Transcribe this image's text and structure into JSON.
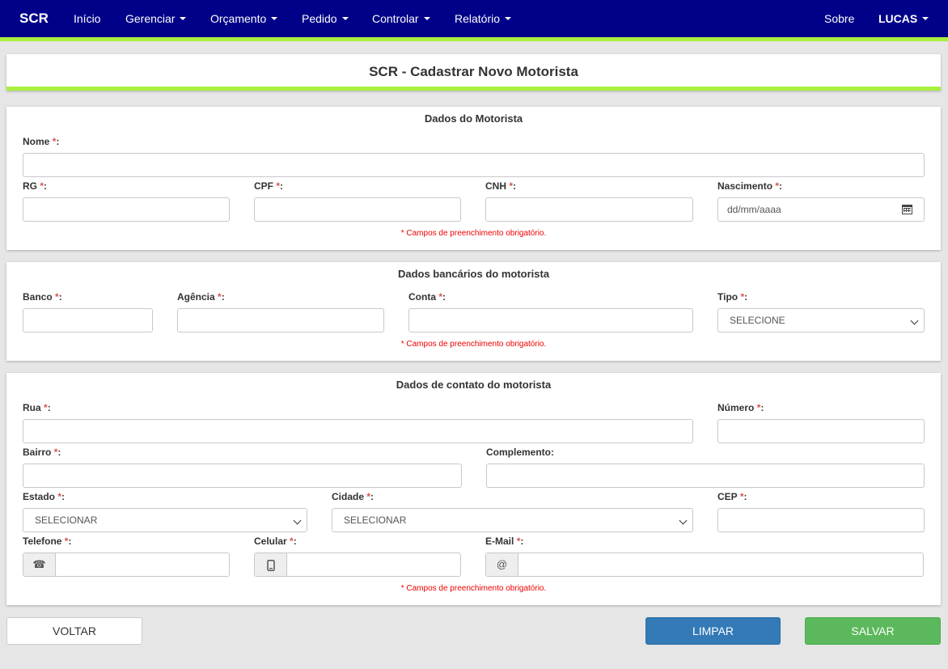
{
  "nav": {
    "brand": "SCR",
    "inicio": "Início",
    "gerenciar": "Gerenciar",
    "orcamento": "Orçamento",
    "pedido": "Pedido",
    "controlar": "Controlar",
    "relatorio": "Relatório",
    "sobre": "Sobre",
    "user": "LUCAS"
  },
  "page": {
    "title": "SCR - Cadastrar Novo Motorista",
    "required_mark": "*",
    "required_note": "* Campos de preenchimento obrigatório."
  },
  "motorista": {
    "title": "Dados do Motorista",
    "nome": "Nome",
    "rg": "RG",
    "cpf": "CPF",
    "cnh": "CNH",
    "nascimento": "Nascimento",
    "nascimento_placeholder": "dd/mm/aaaa"
  },
  "banco": {
    "title": "Dados bancários do motorista",
    "banco": "Banco",
    "agencia": "Agência",
    "conta": "Conta",
    "tipo": "Tipo",
    "tipo_value": "SELECIONE"
  },
  "contato": {
    "title": "Dados de contato do motorista",
    "rua": "Rua",
    "numero": "Número",
    "bairro": "Bairro",
    "complemento": "Complemento:",
    "estado": "Estado",
    "estado_value": "SELECIONAR",
    "cidade": "Cidade",
    "cidade_value": "SELECIONAR",
    "cep": "CEP",
    "telefone": "Telefone",
    "celular": "Celular",
    "email": "E-Mail",
    "email_addon": "@"
  },
  "buttons": {
    "voltar": "VOLTAR",
    "limpar": "LIMPAR",
    "salvar": "SALVAR"
  }
}
